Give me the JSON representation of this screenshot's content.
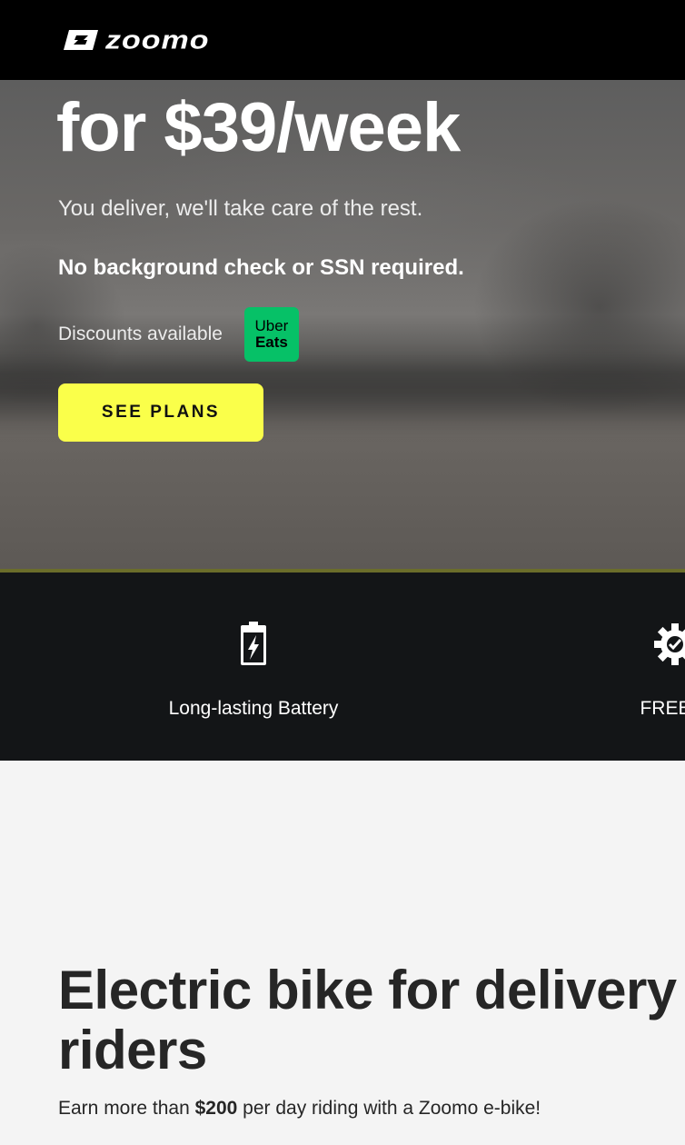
{
  "header": {
    "logo_text": "zoomo",
    "logo_icon": "zoomo-mark-icon"
  },
  "hero": {
    "title_line_2": "for $39/week",
    "subtitle": "You deliver, we'll take care of the rest.",
    "note": "No background check or SSN required.",
    "discounts_label": "Discounts available",
    "partner_badge": {
      "line1": "Uber",
      "line2": "Eats",
      "color": "#06c167"
    },
    "cta_label": "SEE PLANS",
    "cta_color": "#faff4a"
  },
  "features": [
    {
      "icon": "battery-icon",
      "label": "Long-lasting Battery"
    },
    {
      "icon": "gear-icon",
      "label": "FREE R"
    }
  ],
  "section": {
    "title": "Electric bike for delivery riders",
    "body_prefix": "Earn more than ",
    "body_amount": "$200",
    "body_suffix": " per day riding with a Zoomo e-bike!"
  },
  "colors": {
    "header_bg": "#000000",
    "features_bg": "#131517",
    "page_bg": "#f4f4f4",
    "text_dark": "#262626"
  }
}
